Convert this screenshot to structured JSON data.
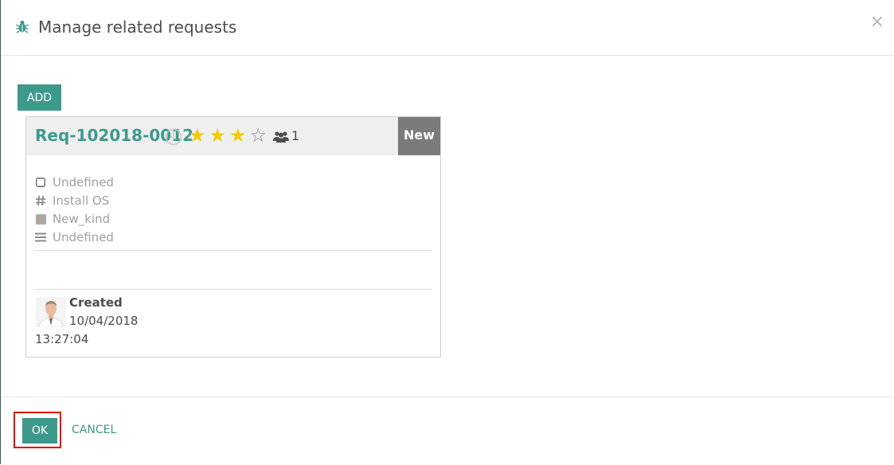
{
  "dialog": {
    "title": "Manage related requests",
    "close_glyph": "×"
  },
  "toolbar": {
    "add_label": "ADD"
  },
  "request_card": {
    "reference": "Req-102018-0012",
    "priority_stars_filled": 3,
    "priority_stars_total": 4,
    "followers_count": "1",
    "state": "New",
    "fields": [
      {
        "icon": "checkbox-icon",
        "label": "Undefined"
      },
      {
        "icon": "hash-icon",
        "label": "Install OS"
      },
      {
        "icon": "square-icon",
        "label": "New_kind"
      },
      {
        "icon": "list-icon",
        "label": "Undefined"
      }
    ],
    "created_label": "Created",
    "created_date": "10/04/2018",
    "created_time": "13:27:04"
  },
  "footer": {
    "ok_label": "OK",
    "cancel_label": "CANCEL"
  },
  "colors": {
    "accent": "#3d9a8b",
    "star": "#f3cc00",
    "state_bg": "#7b7b7b",
    "highlight": "#e00000"
  }
}
